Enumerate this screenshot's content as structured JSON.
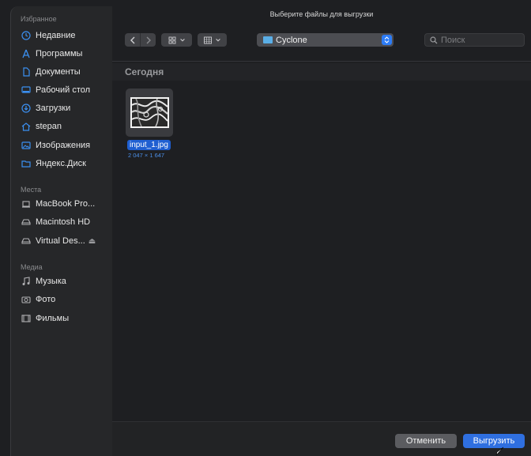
{
  "dialog": {
    "title": "Выберите файлы для выгрузки"
  },
  "sidebar": {
    "favorites_header": "Избранное",
    "favorites": [
      {
        "label": "Недавние",
        "icon": "clock-icon"
      },
      {
        "label": "Программы",
        "icon": "apps-icon"
      },
      {
        "label": "Документы",
        "icon": "document-icon"
      },
      {
        "label": "Рабочий стол",
        "icon": "desktop-icon"
      },
      {
        "label": "Загрузки",
        "icon": "download-icon"
      },
      {
        "label": "stepan",
        "icon": "home-icon"
      },
      {
        "label": "Изображения",
        "icon": "photo-icon"
      },
      {
        "label": "Яндекс.Диск",
        "icon": "folder-icon"
      }
    ],
    "places_header": "Места",
    "places": [
      {
        "label": "MacBook Pro...",
        "icon": "laptop-icon"
      },
      {
        "label": "Macintosh HD",
        "icon": "drive-icon"
      },
      {
        "label": "Virtual Des...",
        "icon": "drive-icon",
        "eject": "⏏"
      }
    ],
    "media_header": "Медиа",
    "media": [
      {
        "label": "Музыка",
        "icon": "music-icon"
      },
      {
        "label": "Фото",
        "icon": "camera-icon"
      },
      {
        "label": "Фильмы",
        "icon": "film-icon"
      }
    ]
  },
  "toolbar": {
    "location": "Cyclone",
    "search_placeholder": "Поиск"
  },
  "content": {
    "group_label": "Сегодня",
    "files": [
      {
        "name": "input_1.jpg",
        "dimensions": "2 047 × 1 647"
      }
    ]
  },
  "footer": {
    "cancel_label": "Отменить",
    "upload_label": "Выгрузить"
  },
  "colors": {
    "accent": "#2f6fe0",
    "icon_blue": "#3b8ff0",
    "background": "#1e1f22"
  }
}
